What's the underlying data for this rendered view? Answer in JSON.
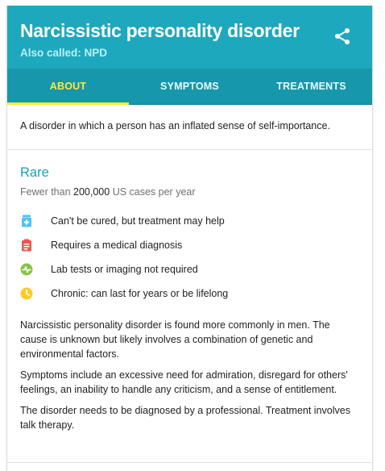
{
  "header": {
    "title": "Narcissistic personality disorder",
    "subtitle": "Also called: NPD",
    "share_icon": "share-icon",
    "background_color": "#1ea8be"
  },
  "tabs": [
    {
      "label": "ABOUT",
      "active": true
    },
    {
      "label": "SYMPTOMS",
      "active": false
    },
    {
      "label": "TREATMENTS",
      "active": false
    }
  ],
  "summary": "A disorder in which a person has an inflated sense of self-importance.",
  "rarity": {
    "heading": "Rare",
    "prefix": "Fewer than",
    "count": "200,000",
    "suffix": "US cases per year"
  },
  "facts": [
    {
      "icon": "medicine-bottle-icon",
      "color": "#4fc3f7",
      "label": "Can't be cured, but treatment may help"
    },
    {
      "icon": "clipboard-icon",
      "color": "#ef5350",
      "label": "Requires a medical diagnosis"
    },
    {
      "icon": "pulse-icon",
      "color": "#8bc34a",
      "label": "Lab tests or imaging not required"
    },
    {
      "icon": "clock-icon",
      "color": "#ffca28",
      "label": "Chronic: can last for years or be lifelong"
    }
  ],
  "paragraphs": [
    "Narcissistic personality disorder is found more commonly in men. The cause is unknown but likely involves a combination of genetic and environmental factors.",
    "Symptoms include an excessive need for admiration, disregard for others' feelings, an inability to handle any criticism, and a sense of entitlement.",
    "The disorder needs to be diagnosed by a professional. Treatment involves talk therapy."
  ]
}
